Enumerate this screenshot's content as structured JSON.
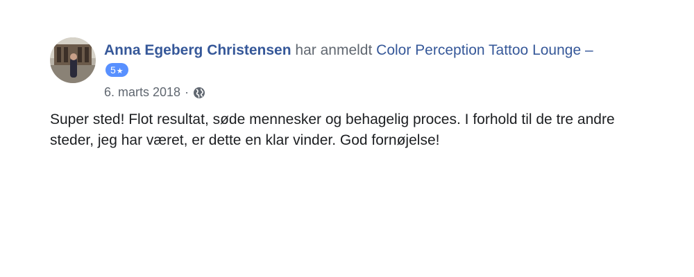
{
  "review": {
    "author": "Anna Egeberg Christensen",
    "action": "har anmeldt",
    "page_name": "Color Perception Tattoo Lounge",
    "dash": "–",
    "rating": "5",
    "rating_icon": "star-icon",
    "date": "6. marts 2018",
    "separator": "·",
    "privacy_icon": "globe-icon",
    "text": "Super sted! Flot resultat, søde mennesker og behagelig proces. I forhold til de tre andre steder, jeg har været, er dette en klar vinder. God fornøjelse!"
  },
  "colors": {
    "link": "#365899",
    "meta": "#606770",
    "badge": "#5890ff",
    "body_text": "#1c1e21"
  }
}
